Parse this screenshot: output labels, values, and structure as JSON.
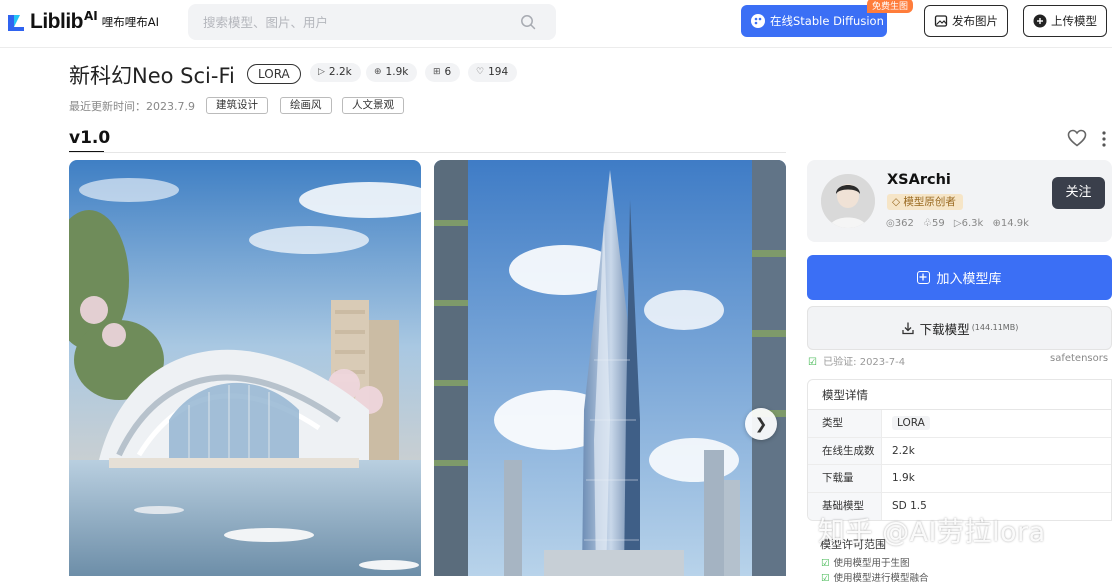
{
  "header": {
    "logo_text": "Liblib",
    "logo_ai": "AI",
    "logo_cn": "哩布哩布AI",
    "search_placeholder": "搜索模型、图片、用户",
    "sd_button": "在线Stable Diffusion",
    "free_badge": "免费生图",
    "publish_button": "发布图片",
    "upload_button": "上传模型"
  },
  "model": {
    "title": "新科幻Neo Sci-Fi",
    "type_tag": "LORA",
    "stats": [
      {
        "icon": "play-icon",
        "glyph": "▷",
        "value": "2.2k"
      },
      {
        "icon": "download-icon",
        "glyph": "⊕",
        "value": "1.9k"
      },
      {
        "icon": "image-icon",
        "glyph": "⊞",
        "value": "6"
      },
      {
        "icon": "heart-icon",
        "glyph": "♡",
        "value": "194"
      }
    ],
    "updated": "最近更新时间：2023.7.9",
    "tags": [
      "建筑设计",
      "绘画风",
      "人文景观"
    ],
    "version": "v1.0"
  },
  "author": {
    "name": "XSArchi",
    "badge": "模型原创者",
    "stats": [
      "◎362",
      "♧59",
      "▷6.3k",
      "⊕14.9k"
    ],
    "follow": "关注"
  },
  "actions": {
    "add_to_library": "加入模型库",
    "download": "下载模型",
    "download_size": "(144.11MB)",
    "verified": "已验证: 2023-7-4",
    "format": "safetensors"
  },
  "details": {
    "title": "模型详情",
    "rows": [
      {
        "key": "类型",
        "value": "LORA"
      },
      {
        "key": "在线生成数",
        "value": "2.2k"
      },
      {
        "key": "下载量",
        "value": "1.9k"
      },
      {
        "key": "基础模型",
        "value": "SD 1.5"
      }
    ]
  },
  "license": {
    "title": "模型许可范围",
    "items": [
      "使用模型用于生图",
      "使用模型进行模型融合"
    ]
  },
  "watermark": "知乎 @AI劳拉lora",
  "colors": {
    "primary": "#3b6ff5",
    "badge_orange": "#ff7d3b",
    "creator_badge_bg": "#f6e5c7",
    "follow_bg": "#3a3f4b"
  }
}
